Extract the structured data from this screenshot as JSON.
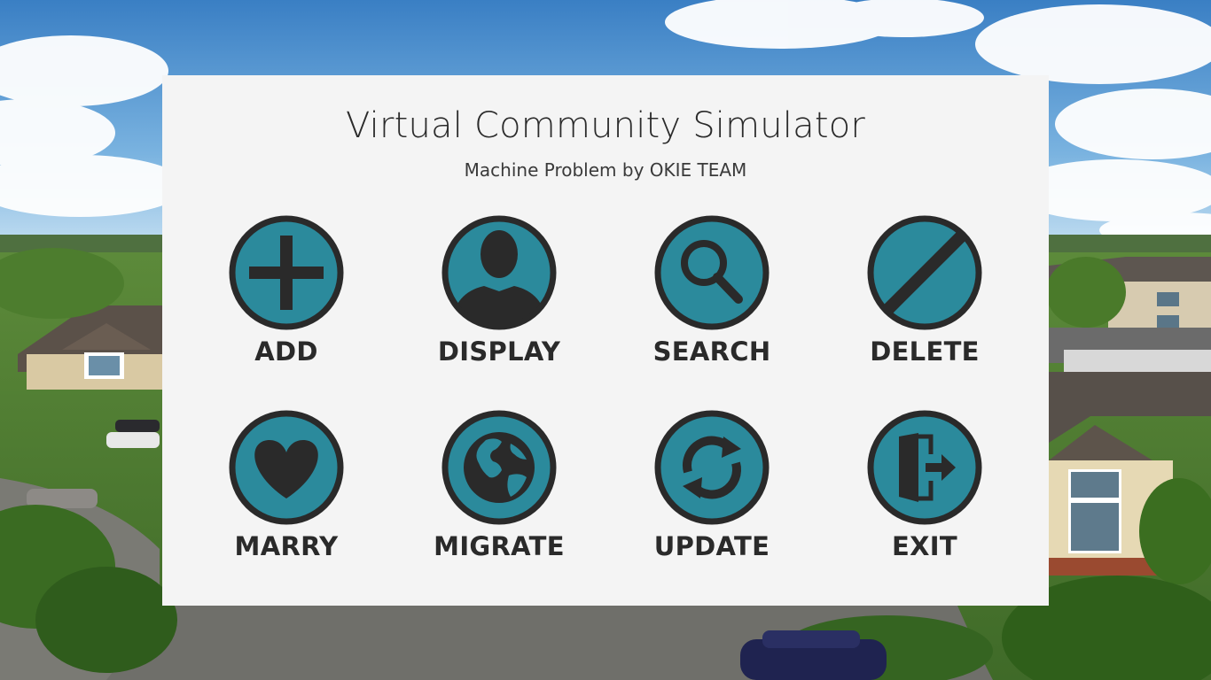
{
  "app": {
    "title": "Virtual Community Simulator",
    "subtitle": "Machine Problem by OKIE TEAM"
  },
  "theme": {
    "panel_bg": "#f4f4f4",
    "icon_fill": "#2b8a9c",
    "icon_stroke": "#2a2a2a"
  },
  "menu": {
    "items": [
      {
        "label": "ADD",
        "icon": "plus-icon"
      },
      {
        "label": "DISPLAY",
        "icon": "person-icon"
      },
      {
        "label": "SEARCH",
        "icon": "magnifier-icon"
      },
      {
        "label": "DELETE",
        "icon": "slash-icon"
      },
      {
        "label": "MARRY",
        "icon": "heart-icon"
      },
      {
        "label": "MIGRATE",
        "icon": "globe-icon"
      },
      {
        "label": "UPDATE",
        "icon": "refresh-icon"
      },
      {
        "label": "EXIT",
        "icon": "exit-door-icon"
      }
    ]
  }
}
